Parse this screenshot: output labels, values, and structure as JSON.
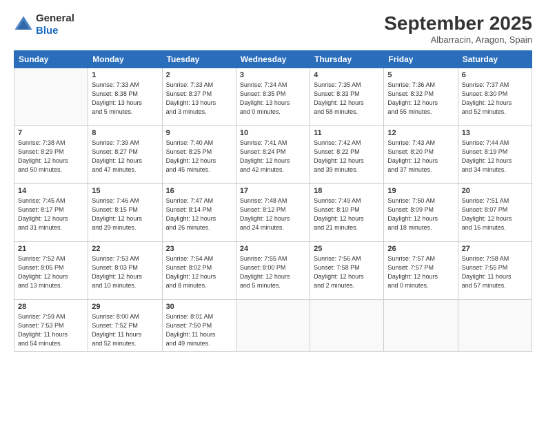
{
  "logo": {
    "general": "General",
    "blue": "Blue"
  },
  "title": {
    "month_year": "September 2025",
    "location": "Albarracin, Aragon, Spain"
  },
  "weekdays": [
    "Sunday",
    "Monday",
    "Tuesday",
    "Wednesday",
    "Thursday",
    "Friday",
    "Saturday"
  ],
  "weeks": [
    [
      {
        "day": "",
        "info": ""
      },
      {
        "day": "1",
        "info": "Sunrise: 7:33 AM\nSunset: 8:38 PM\nDaylight: 13 hours\nand 5 minutes."
      },
      {
        "day": "2",
        "info": "Sunrise: 7:33 AM\nSunset: 8:37 PM\nDaylight: 13 hours\nand 3 minutes."
      },
      {
        "day": "3",
        "info": "Sunrise: 7:34 AM\nSunset: 8:35 PM\nDaylight: 13 hours\nand 0 minutes."
      },
      {
        "day": "4",
        "info": "Sunrise: 7:35 AM\nSunset: 8:33 PM\nDaylight: 12 hours\nand 58 minutes."
      },
      {
        "day": "5",
        "info": "Sunrise: 7:36 AM\nSunset: 8:32 PM\nDaylight: 12 hours\nand 55 minutes."
      },
      {
        "day": "6",
        "info": "Sunrise: 7:37 AM\nSunset: 8:30 PM\nDaylight: 12 hours\nand 52 minutes."
      }
    ],
    [
      {
        "day": "7",
        "info": "Sunrise: 7:38 AM\nSunset: 8:29 PM\nDaylight: 12 hours\nand 50 minutes."
      },
      {
        "day": "8",
        "info": "Sunrise: 7:39 AM\nSunset: 8:27 PM\nDaylight: 12 hours\nand 47 minutes."
      },
      {
        "day": "9",
        "info": "Sunrise: 7:40 AM\nSunset: 8:25 PM\nDaylight: 12 hours\nand 45 minutes."
      },
      {
        "day": "10",
        "info": "Sunrise: 7:41 AM\nSunset: 8:24 PM\nDaylight: 12 hours\nand 42 minutes."
      },
      {
        "day": "11",
        "info": "Sunrise: 7:42 AM\nSunset: 8:22 PM\nDaylight: 12 hours\nand 39 minutes."
      },
      {
        "day": "12",
        "info": "Sunrise: 7:43 AM\nSunset: 8:20 PM\nDaylight: 12 hours\nand 37 minutes."
      },
      {
        "day": "13",
        "info": "Sunrise: 7:44 AM\nSunset: 8:19 PM\nDaylight: 12 hours\nand 34 minutes."
      }
    ],
    [
      {
        "day": "14",
        "info": "Sunrise: 7:45 AM\nSunset: 8:17 PM\nDaylight: 12 hours\nand 31 minutes."
      },
      {
        "day": "15",
        "info": "Sunrise: 7:46 AM\nSunset: 8:15 PM\nDaylight: 12 hours\nand 29 minutes."
      },
      {
        "day": "16",
        "info": "Sunrise: 7:47 AM\nSunset: 8:14 PM\nDaylight: 12 hours\nand 26 minutes."
      },
      {
        "day": "17",
        "info": "Sunrise: 7:48 AM\nSunset: 8:12 PM\nDaylight: 12 hours\nand 24 minutes."
      },
      {
        "day": "18",
        "info": "Sunrise: 7:49 AM\nSunset: 8:10 PM\nDaylight: 12 hours\nand 21 minutes."
      },
      {
        "day": "19",
        "info": "Sunrise: 7:50 AM\nSunset: 8:09 PM\nDaylight: 12 hours\nand 18 minutes."
      },
      {
        "day": "20",
        "info": "Sunrise: 7:51 AM\nSunset: 8:07 PM\nDaylight: 12 hours\nand 16 minutes."
      }
    ],
    [
      {
        "day": "21",
        "info": "Sunrise: 7:52 AM\nSunset: 8:05 PM\nDaylight: 12 hours\nand 13 minutes."
      },
      {
        "day": "22",
        "info": "Sunrise: 7:53 AM\nSunset: 8:03 PM\nDaylight: 12 hours\nand 10 minutes."
      },
      {
        "day": "23",
        "info": "Sunrise: 7:54 AM\nSunset: 8:02 PM\nDaylight: 12 hours\nand 8 minutes."
      },
      {
        "day": "24",
        "info": "Sunrise: 7:55 AM\nSunset: 8:00 PM\nDaylight: 12 hours\nand 5 minutes."
      },
      {
        "day": "25",
        "info": "Sunrise: 7:56 AM\nSunset: 7:58 PM\nDaylight: 12 hours\nand 2 minutes."
      },
      {
        "day": "26",
        "info": "Sunrise: 7:57 AM\nSunset: 7:57 PM\nDaylight: 12 hours\nand 0 minutes."
      },
      {
        "day": "27",
        "info": "Sunrise: 7:58 AM\nSunset: 7:55 PM\nDaylight: 11 hours\nand 57 minutes."
      }
    ],
    [
      {
        "day": "28",
        "info": "Sunrise: 7:59 AM\nSunset: 7:53 PM\nDaylight: 11 hours\nand 54 minutes."
      },
      {
        "day": "29",
        "info": "Sunrise: 8:00 AM\nSunset: 7:52 PM\nDaylight: 11 hours\nand 52 minutes."
      },
      {
        "day": "30",
        "info": "Sunrise: 8:01 AM\nSunset: 7:50 PM\nDaylight: 11 hours\nand 49 minutes."
      },
      {
        "day": "",
        "info": ""
      },
      {
        "day": "",
        "info": ""
      },
      {
        "day": "",
        "info": ""
      },
      {
        "day": "",
        "info": ""
      }
    ]
  ]
}
